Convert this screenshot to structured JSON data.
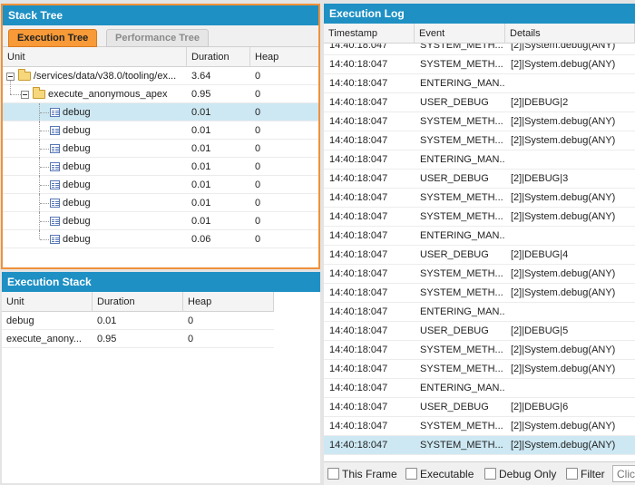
{
  "stack_tree": {
    "title": "Stack Tree",
    "tabs": [
      {
        "label": "Execution Tree",
        "active": true
      },
      {
        "label": "Performance Tree",
        "active": false
      }
    ],
    "columns": [
      "Unit",
      "Duration",
      "Heap"
    ],
    "rows": [
      {
        "unit": "/services/data/v38.0/tooling/ex...",
        "duration": "3.64",
        "heap": "0",
        "level": 0,
        "type": "folder"
      },
      {
        "unit": "execute_anonymous_apex",
        "duration": "0.95",
        "heap": "0",
        "level": 1,
        "type": "folder"
      },
      {
        "unit": "debug",
        "duration": "0.01",
        "heap": "0",
        "level": 2,
        "type": "leaf"
      },
      {
        "unit": "debug",
        "duration": "0.01",
        "heap": "0",
        "level": 2,
        "type": "leaf"
      },
      {
        "unit": "debug",
        "duration": "0.01",
        "heap": "0",
        "level": 2,
        "type": "leaf"
      },
      {
        "unit": "debug",
        "duration": "0.01",
        "heap": "0",
        "level": 2,
        "type": "leaf"
      },
      {
        "unit": "debug",
        "duration": "0.01",
        "heap": "0",
        "level": 2,
        "type": "leaf"
      },
      {
        "unit": "debug",
        "duration": "0.01",
        "heap": "0",
        "level": 2,
        "type": "leaf"
      },
      {
        "unit": "debug",
        "duration": "0.01",
        "heap": "0",
        "level": 2,
        "type": "leaf"
      },
      {
        "unit": "debug",
        "duration": "0.06",
        "heap": "0",
        "level": 2,
        "type": "leaf"
      }
    ],
    "selected_row": 2
  },
  "execution_stack": {
    "title": "Execution Stack",
    "columns": [
      "Unit",
      "Duration",
      "Heap"
    ],
    "rows": [
      {
        "unit": "debug",
        "duration": "0.01",
        "heap": "0"
      },
      {
        "unit": "execute_anony...",
        "duration": "0.95",
        "heap": "0"
      }
    ]
  },
  "execution_log": {
    "title": "Execution Log",
    "columns": [
      "Timestamp",
      "Event",
      "Details"
    ],
    "rows": [
      {
        "timestamp": "14:40:18:047",
        "event": "SYSTEM_METH...",
        "details": "[2]|System.debug(ANY)"
      },
      {
        "timestamp": "14:40:18:047",
        "event": "SYSTEM_METH...",
        "details": "[2]|System.debug(ANY)"
      },
      {
        "timestamp": "14:40:18:047",
        "event": "ENTERING_MAN...",
        "details": ""
      },
      {
        "timestamp": "14:40:18:047",
        "event": "USER_DEBUG",
        "details": "[2]|DEBUG|2"
      },
      {
        "timestamp": "14:40:18:047",
        "event": "SYSTEM_METH...",
        "details": "[2]|System.debug(ANY)"
      },
      {
        "timestamp": "14:40:18:047",
        "event": "SYSTEM_METH...",
        "details": "[2]|System.debug(ANY)"
      },
      {
        "timestamp": "14:40:18:047",
        "event": "ENTERING_MAN...",
        "details": ""
      },
      {
        "timestamp": "14:40:18:047",
        "event": "USER_DEBUG",
        "details": "[2]|DEBUG|3"
      },
      {
        "timestamp": "14:40:18:047",
        "event": "SYSTEM_METH...",
        "details": "[2]|System.debug(ANY)"
      },
      {
        "timestamp": "14:40:18:047",
        "event": "SYSTEM_METH...",
        "details": "[2]|System.debug(ANY)"
      },
      {
        "timestamp": "14:40:18:047",
        "event": "ENTERING_MAN...",
        "details": ""
      },
      {
        "timestamp": "14:40:18:047",
        "event": "USER_DEBUG",
        "details": "[2]|DEBUG|4"
      },
      {
        "timestamp": "14:40:18:047",
        "event": "SYSTEM_METH...",
        "details": "[2]|System.debug(ANY)"
      },
      {
        "timestamp": "14:40:18:047",
        "event": "SYSTEM_METH...",
        "details": "[2]|System.debug(ANY)"
      },
      {
        "timestamp": "14:40:18:047",
        "event": "ENTERING_MAN...",
        "details": ""
      },
      {
        "timestamp": "14:40:18:047",
        "event": "USER_DEBUG",
        "details": "[2]|DEBUG|5"
      },
      {
        "timestamp": "14:40:18:047",
        "event": "SYSTEM_METH...",
        "details": "[2]|System.debug(ANY)"
      },
      {
        "timestamp": "14:40:18:047",
        "event": "SYSTEM_METH...",
        "details": "[2]|System.debug(ANY)"
      },
      {
        "timestamp": "14:40:18:047",
        "event": "ENTERING_MAN...",
        "details": ""
      },
      {
        "timestamp": "14:40:18:047",
        "event": "USER_DEBUG",
        "details": "[2]|DEBUG|6"
      },
      {
        "timestamp": "14:40:18:047",
        "event": "SYSTEM_METH...",
        "details": "[2]|System.debug(ANY)"
      },
      {
        "timestamp": "14:40:18:047",
        "event": "SYSTEM_METH...",
        "details": "[2]|System.debug(ANY)"
      }
    ],
    "selected_row": 21,
    "footer": {
      "this_frame_label": "This Frame",
      "executable_label": "Executable",
      "debug_only_label": "Debug Only",
      "filter_label": "Filter",
      "filter_placeholder": "Clic"
    }
  },
  "colors": {
    "title_bar": "#1e90c4",
    "active_tab": "#f79a37",
    "selected_row": "#cde8f3",
    "focus_border": "#f0913a"
  }
}
